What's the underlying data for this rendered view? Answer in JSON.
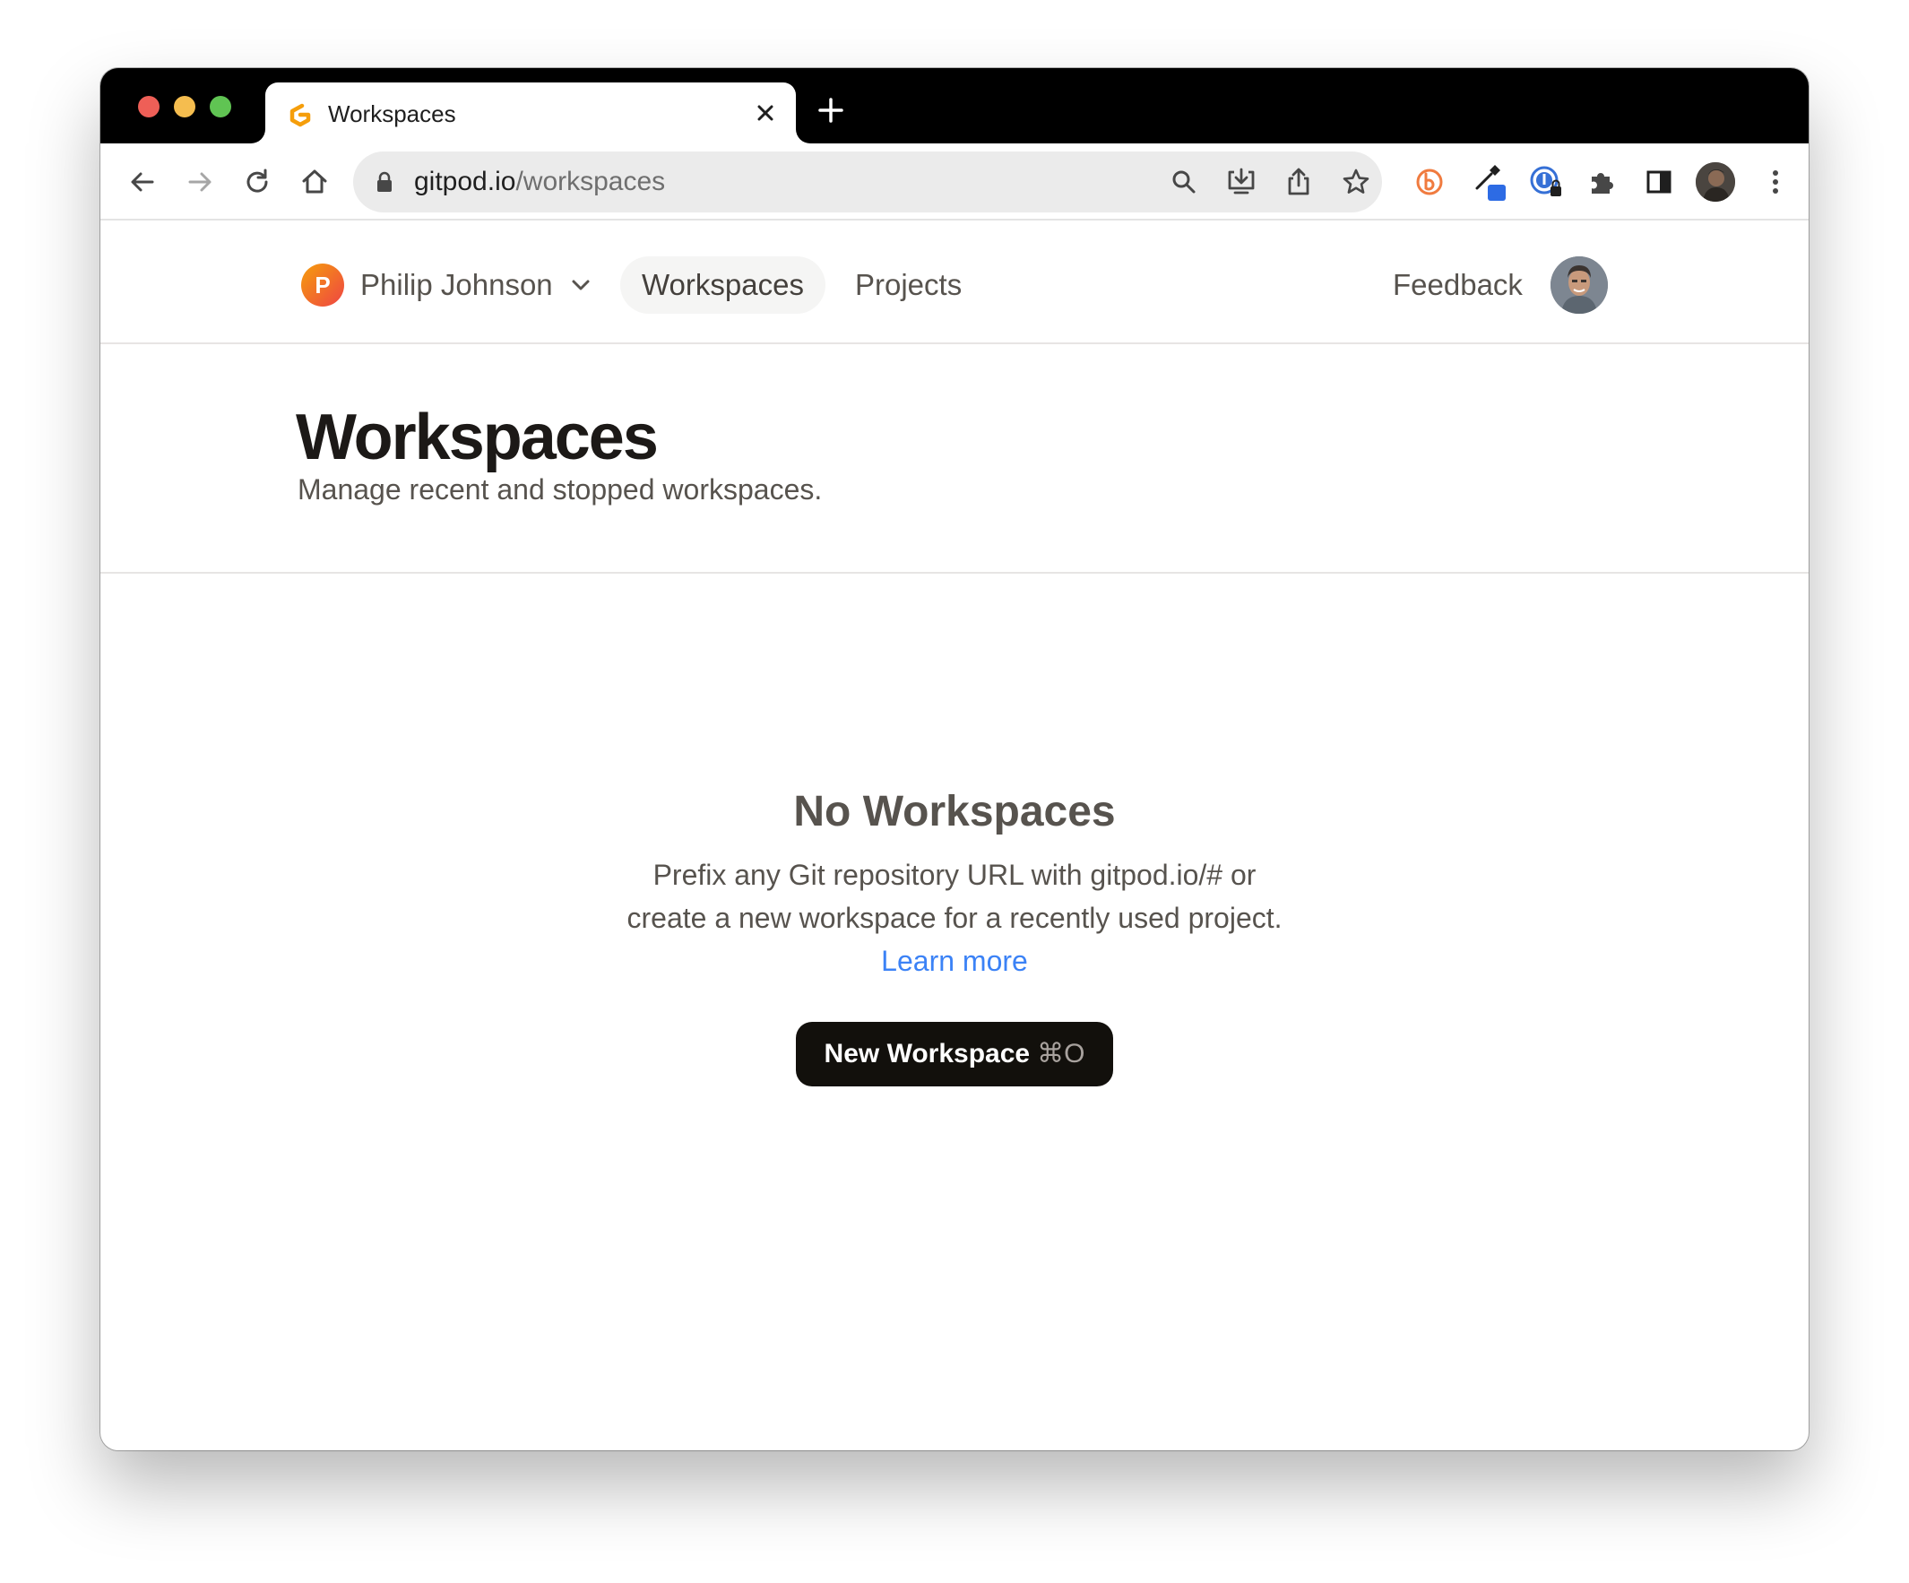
{
  "browser": {
    "tab": {
      "title": "Workspaces",
      "favicon": "gitpod-logo-icon"
    },
    "address_bar": {
      "host": "gitpod.io",
      "path": "/workspaces"
    },
    "toolbar_icons": [
      "back-icon",
      "forward-icon",
      "reload-icon",
      "home-icon",
      "search-icon",
      "install-app-icon",
      "share-icon",
      "bookmark-star-icon",
      "extension-b-icon",
      "eyedropper-extension-icon",
      "password-manager-icon",
      "extensions-puzzle-icon",
      "side-panel-icon",
      "profile-avatar",
      "menu-kebab-icon"
    ]
  },
  "header": {
    "team": {
      "initial": "P",
      "name": "Philip Johnson"
    },
    "nav": {
      "workspaces": "Workspaces",
      "projects": "Projects",
      "feedback": "Feedback"
    }
  },
  "page": {
    "title": "Workspaces",
    "subtitle": "Manage recent and stopped workspaces."
  },
  "empty_state": {
    "title": "No Workspaces",
    "description_line1": "Prefix any Git repository URL with gitpod.io/# or",
    "description_line2": "create a new workspace for a recently used project.",
    "link": "Learn more",
    "button_label": "New Workspace",
    "button_shortcut": "⌘O"
  },
  "colors": {
    "link": "#3b82f6",
    "primary_button": "#12100c",
    "text_muted": "#57534e",
    "heading": "#1c1917"
  }
}
